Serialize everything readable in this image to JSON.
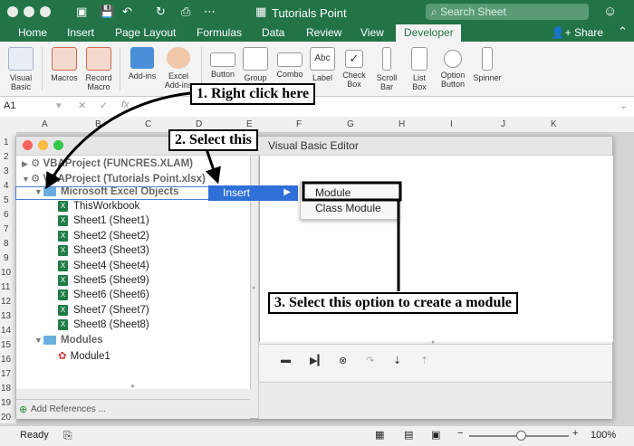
{
  "app": {
    "title": "Tutorials Point",
    "search_placeholder": "Search Sheet",
    "share_label": "Share"
  },
  "ribbon_tabs": [
    "Home",
    "Insert",
    "Page Layout",
    "Formulas",
    "Data",
    "Review",
    "View",
    "Developer"
  ],
  "active_tab": "Developer",
  "ribbon_buttons": [
    {
      "label": "Visual\nBasic",
      "icon": "visual-basic-icon"
    },
    {
      "label": "Macros",
      "icon": "macros-icon"
    },
    {
      "label": "Record\nMacro",
      "icon": "record-macro-icon"
    },
    {
      "label": "Add-ins",
      "icon": "addins-icon"
    },
    {
      "label": "Excel\nAdd-ins",
      "icon": "excel-addins-icon"
    },
    {
      "label": "Button",
      "icon": "button-control-icon"
    },
    {
      "label": "Group",
      "icon": "group-box-icon"
    },
    {
      "label": "Combo",
      "icon": "combo-box-icon"
    },
    {
      "label": "Label",
      "icon": "label-control-icon"
    },
    {
      "label": "Check\nBox",
      "icon": "checkbox-icon"
    },
    {
      "label": "Scroll\nBar",
      "icon": "scrollbar-icon"
    },
    {
      "label": "List\nBox",
      "icon": "listbox-icon"
    },
    {
      "label": "Option\nButton",
      "icon": "option-button-icon"
    },
    {
      "label": "Spinner",
      "icon": "spinner-icon"
    }
  ],
  "formula_bar": {
    "name_box": "A1"
  },
  "columns": [
    "A",
    "B",
    "C",
    "D",
    "E",
    "F",
    "G",
    "H",
    "I",
    "J",
    "K"
  ],
  "rows": [
    "1",
    "2",
    "3",
    "4",
    "5",
    "6",
    "7",
    "8",
    "9",
    "10",
    "11",
    "12",
    "13",
    "14",
    "15",
    "16",
    "17",
    "18",
    "19",
    "20"
  ],
  "vba_window": {
    "title": "Visual Basic Editor",
    "add_references": "Add References ...",
    "projects": [
      {
        "label": "VBAProject (FUNCRES.XLAM)",
        "expanded": false
      },
      {
        "label": "VBAProject (Tutorials Point.xlsx)",
        "expanded": true
      }
    ],
    "excel_objects_folder": "Microsoft Excel Objects",
    "objects": [
      "ThisWorkbook",
      "Sheet1 (Sheet1)",
      "Sheet2 (Sheet2)",
      "Sheet3 (Sheet3)",
      "Sheet4 (Sheet4)",
      "Sheet5 (Sheet9)",
      "Sheet6 (Sheet6)",
      "Sheet7 (Sheet7)",
      "Sheet8 (Sheet8)"
    ],
    "modules_folder": "Modules",
    "modules": [
      "Module1"
    ]
  },
  "context_menu": {
    "item": "Insert",
    "submenu": [
      "Module",
      "Class Module"
    ]
  },
  "callouts": {
    "step1": "1. Right click here",
    "step2": "2. Select this",
    "step3": "3. Select this option to create a module"
  },
  "status": {
    "ready": "Ready",
    "zoom": "100%"
  },
  "colors": {
    "excel_green": "#227447",
    "menu_highlight": "#2f6fd8"
  }
}
